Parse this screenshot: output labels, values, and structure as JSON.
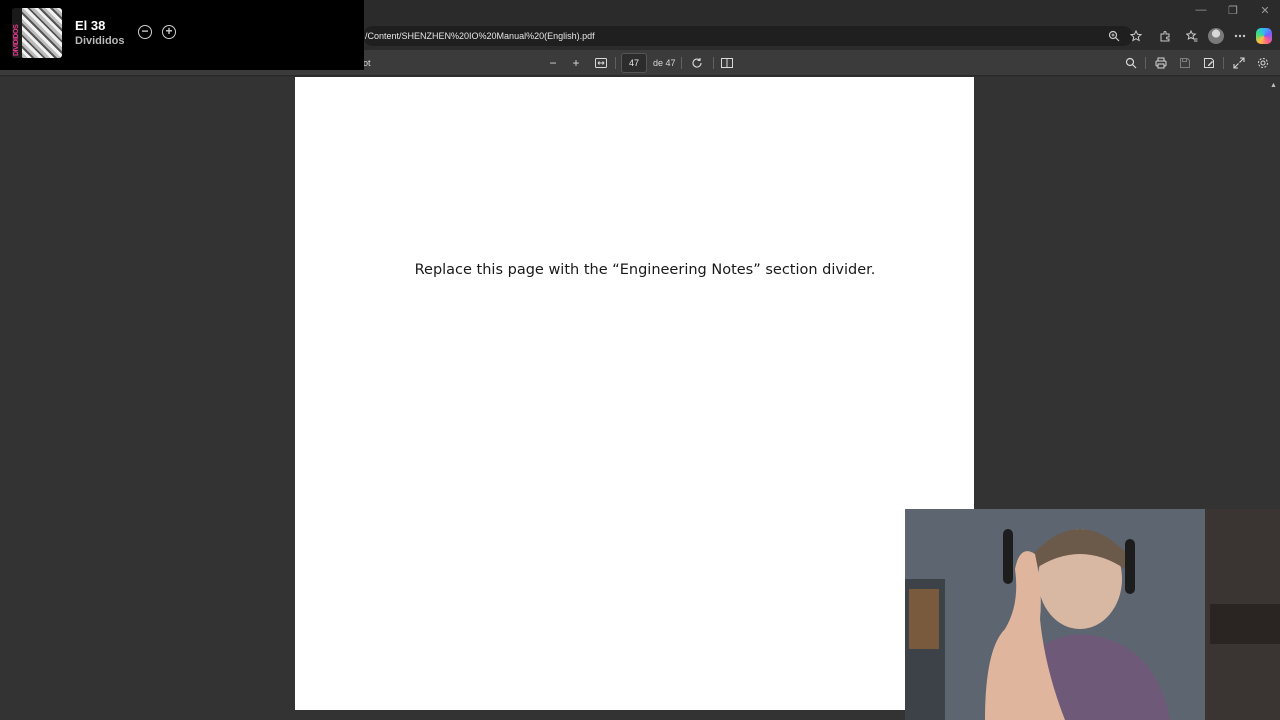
{
  "media": {
    "album_band_text": "DIVIDIDOS",
    "title": "El 38",
    "artist": "Divididos",
    "minus_symbol": "−",
    "plus_symbol": "+"
  },
  "browser": {
    "address": "/Content/SHENZHEN%20IO%20Manual%20(English).pdf",
    "window_controls": [
      "—",
      "❐",
      "✕"
    ]
  },
  "pdf_toolbar": {
    "label_fragment": "ot",
    "zoom_out": "−",
    "zoom_in": "+",
    "page_current": "47",
    "page_total": "de 47"
  },
  "pdf_page": {
    "text": "Replace this page with the “Engineering Notes” section divider."
  }
}
